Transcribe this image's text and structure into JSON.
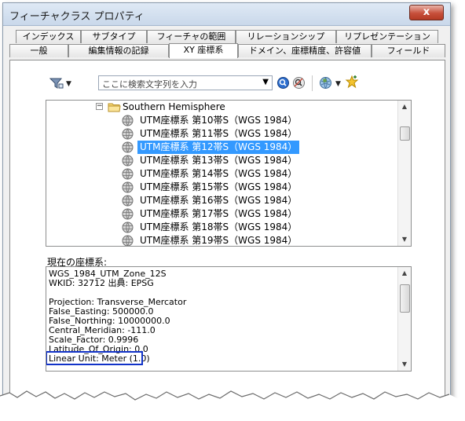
{
  "window": {
    "title": "フィーチャクラス プロパティ",
    "close_label": "x"
  },
  "tabs_back": [
    "インデックス",
    "サブタイプ",
    "フィーチャの範囲",
    "リレーションシップ",
    "リプレゼンテーション"
  ],
  "tabs_front": [
    "一般",
    "編集情報の記録",
    "XY 座標系",
    "ドメイン、座標精度、許容値",
    "フィールド"
  ],
  "active_tab": "XY 座標系",
  "search": {
    "placeholder": "ここに検索文字列を入力"
  },
  "tree": {
    "folder": "Southern Hemisphere",
    "items": [
      "UTM座標系 第10帯S（WGS 1984）",
      "UTM座標系 第11帯S（WGS 1984）",
      "UTM座標系 第12帯S（WGS 1984）",
      "UTM座標系 第13帯S（WGS 1984）",
      "UTM座標系 第14帯S（WGS 1984）",
      "UTM座標系 第15帯S（WGS 1984）",
      "UTM座標系 第16帯S（WGS 1984）",
      "UTM座標系 第17帯S（WGS 1984）",
      "UTM座標系 第18帯S（WGS 1984）",
      "UTM座標系 第19帯S（WGS 1984）"
    ],
    "selected": "UTM座標系 第12帯S（WGS 1984）"
  },
  "current_label": "現在の座標系:",
  "details": {
    "line1": "WGS_1984_UTM_Zone_12S",
    "line2": "WKID: 32712 出典: EPSG",
    "line3": "Projection: Transverse_Mercator",
    "line4": "False_Easting: 500000.0",
    "line5": "False_Northing: 10000000.0",
    "line6": "Central_Meridian: -111.0",
    "line7": "Scale_Factor: 0.9996",
    "line8": "Latitude_Of_Origin: 0.0",
    "line9": "Linear Unit: Meter (1.0)"
  },
  "colors": {
    "selection": "#3399ff",
    "highlight_box": "#1233c8"
  }
}
